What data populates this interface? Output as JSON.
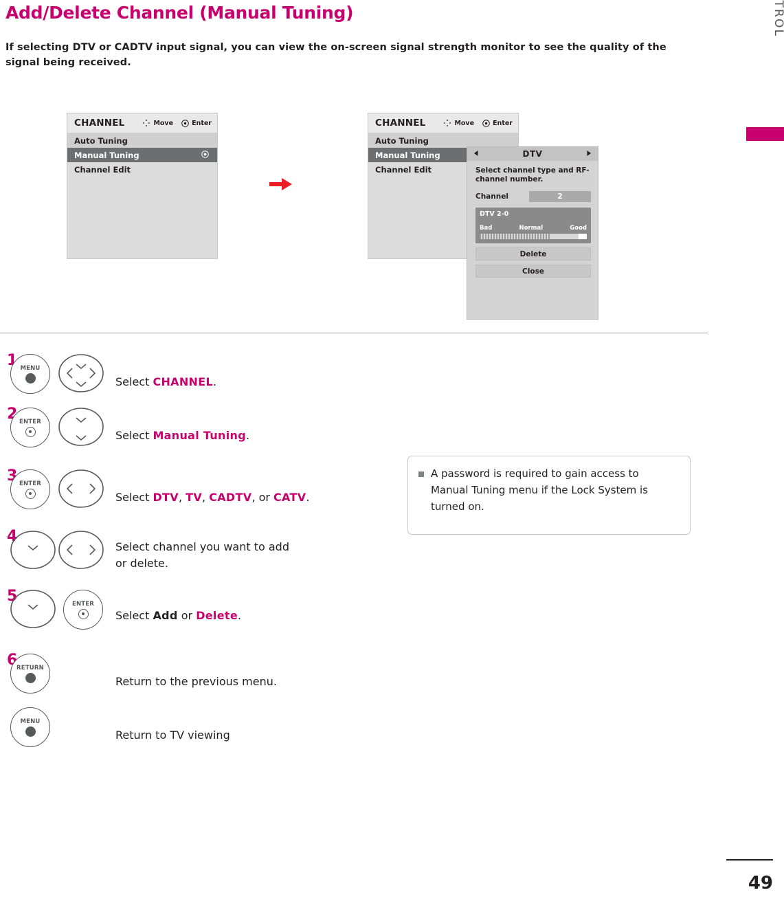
{
  "page": {
    "title": "Add/Delete Channel (Manual Tuning)",
    "intro": "If selecting DTV or CADTV input signal, you can view the on-screen signal strength monitor to see the quality of the signal being received.",
    "running_head": "WATCHING TV / CHANNEL CONTROL",
    "page_number": "49"
  },
  "osd_left": {
    "title": "CHANNEL",
    "hint_move": "Move",
    "hint_enter": "Enter",
    "rows": [
      {
        "label": "Auto Tuning"
      },
      {
        "label": "Manual Tuning"
      },
      {
        "label": "Channel Edit"
      }
    ]
  },
  "osd_right": {
    "title": "CHANNEL",
    "hint_move": "Move",
    "hint_enter": "Enter",
    "rows": [
      {
        "label": "Auto Tuning"
      },
      {
        "label": "Manual Tuning"
      },
      {
        "label": "Channel Edit"
      }
    ],
    "dialog": {
      "header": "DTV",
      "description": "Select channel type and RF-channel number.",
      "channel_label": "Channel",
      "channel_value": "2",
      "signal_title": "DTV 2-0",
      "scale_bad": "Bad",
      "scale_normal": "Normal",
      "scale_good": "Good",
      "button_delete": "Delete",
      "button_close": "Close"
    }
  },
  "steps": [
    {
      "num": "1",
      "button_label": "MENU",
      "text_prefix": "Select ",
      "text_bold": "CHANNEL",
      "text_suffix": "."
    },
    {
      "num": "2",
      "button_label": "ENTER",
      "text_prefix": "Select ",
      "text_bold": "Manual Tuning",
      "text_suffix": "."
    },
    {
      "num": "3",
      "button_label": "ENTER",
      "text_prefix": "Select ",
      "text_bold": "DTV",
      "text_bold2": "TV",
      "text_bold3": "CADTV",
      "text_bold4": "CATV",
      "text_suffix": "."
    },
    {
      "num": "4",
      "button_label": "",
      "text_line1": "Select channel you want to add",
      "text_line2": "or delete."
    },
    {
      "num": "5",
      "button_label": "ENTER",
      "text_prefix": "Select ",
      "text_bold": "Add",
      "text_mid": " or ",
      "text_bold2": "Delete",
      "text_suffix": "."
    },
    {
      "num": "6",
      "button_label": "RETURN",
      "text_line1": "Return to the previous menu."
    },
    {
      "num": "",
      "button_label": "MENU",
      "text_line1": "Return to TV viewing"
    }
  ],
  "note": {
    "text": "A password is required to gain access to Manual Tuning menu if the Lock System is turned on."
  },
  "colors": {
    "accent": "#c8006e",
    "text": "#231f20",
    "gray": "#58595b"
  }
}
